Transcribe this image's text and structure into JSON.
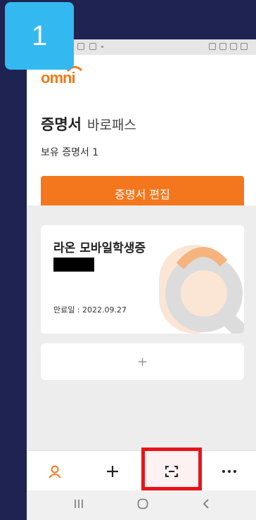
{
  "step": {
    "number": "1"
  },
  "app": {
    "logo_text": "omni",
    "title": "증명서",
    "subtitle": "바로패스",
    "cert_count": "보유 증명서 1",
    "edit_button": "증명서 편집"
  },
  "card": {
    "title": "라온 모바일학생증",
    "expiry": "만료일 : 2022.09.27"
  },
  "add_card": {
    "label": "+"
  },
  "bottom_nav": {
    "items": [
      {
        "icon": "profile-icon"
      },
      {
        "icon": "plus-icon"
      },
      {
        "icon": "scan-qr-icon"
      },
      {
        "icon": "more-icon"
      }
    ]
  },
  "colors": {
    "accent": "#f5771d",
    "highlight": "#e8141b",
    "badge": "#33b9f0",
    "background": "#1f2352"
  }
}
